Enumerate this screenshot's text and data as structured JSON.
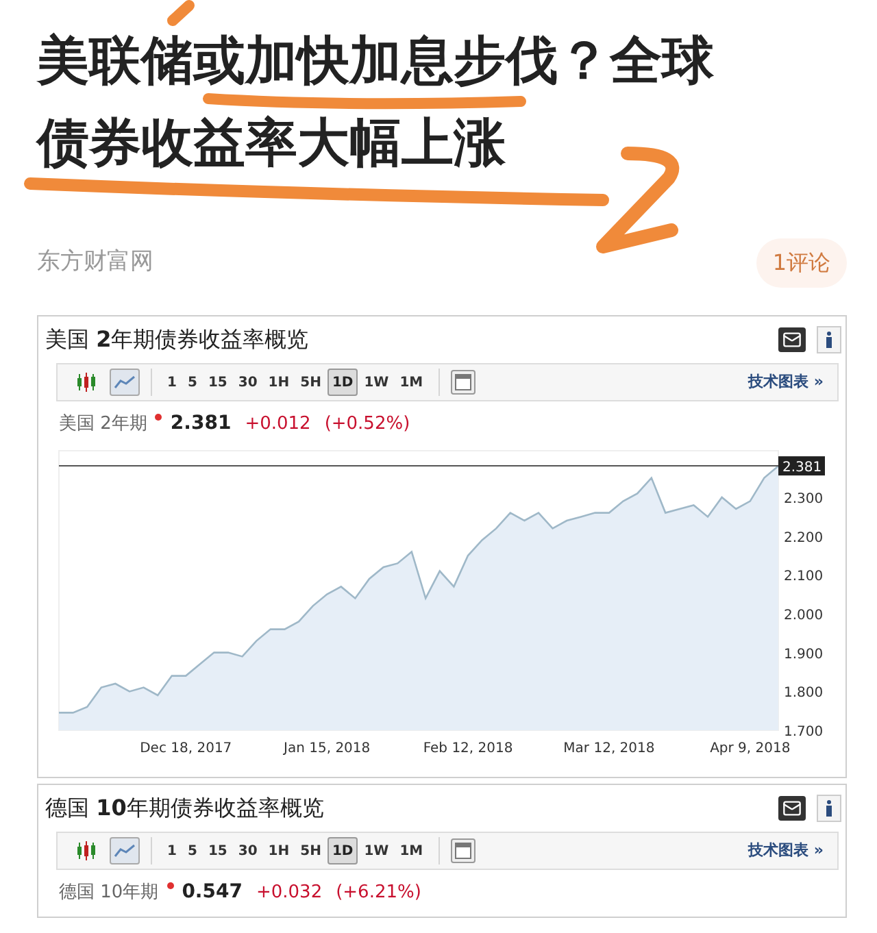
{
  "article": {
    "title_lines": [
      "美联储或加快加息步伐？全球",
      "债券收益率大幅上涨"
    ],
    "source": "东方财富网",
    "comments": "1评论"
  },
  "widgets": [
    {
      "title": "美国 **2**年期债券收益率概览",
      "chart_types": [
        {
          "kind": "candlestick",
          "selected": false
        },
        {
          "kind": "line",
          "selected": true
        }
      ],
      "intervals": [
        {
          "label": "1",
          "selected": false
        },
        {
          "label": "5",
          "selected": false
        },
        {
          "label": "15",
          "selected": false
        },
        {
          "label": "30",
          "selected": false
        },
        {
          "label": "1H",
          "selected": false
        },
        {
          "label": "5H",
          "selected": false
        },
        {
          "label": "1D",
          "selected": true
        },
        {
          "label": "1W",
          "selected": false
        },
        {
          "label": "1M",
          "selected": false
        }
      ],
      "link": "技术图表 »",
      "quote": {
        "name": "美国 2年期",
        "price": "2.381",
        "change": "+0.012",
        "change_pct": "(+0.52%)"
      },
      "chart_data": {
        "type": "area",
        "categories": [
          null,
          null,
          null,
          null,
          null,
          null,
          null,
          null,
          null,
          "Dec 18, 2017",
          null,
          null,
          null,
          null,
          null,
          null,
          null,
          null,
          null,
          "Jan 15, 2018",
          null,
          null,
          null,
          null,
          null,
          null,
          null,
          null,
          null,
          "Feb 12, 2018",
          null,
          null,
          null,
          null,
          null,
          null,
          null,
          null,
          null,
          "Mar 12, 2018",
          null,
          null,
          null,
          null,
          null,
          null,
          null,
          null,
          null,
          "Apr 9, 2018",
          null,
          null
        ],
        "series": [
          {
            "color": "#9fb8c8",
            "values": [
              1.745,
              1.745,
              1.76,
              1.81,
              1.82,
              1.8,
              1.81,
              1.79,
              1.84,
              1.84,
              1.87,
              1.9,
              1.9,
              1.89,
              1.93,
              1.96,
              1.96,
              1.98,
              2.02,
              2.05,
              2.07,
              2.04,
              2.09,
              2.12,
              2.13,
              2.16,
              2.04,
              2.11,
              2.07,
              2.15,
              2.19,
              2.22,
              2.26,
              2.24,
              2.26,
              2.22,
              2.24,
              2.25,
              2.26,
              2.26,
              2.29,
              2.31,
              2.35,
              2.26,
              2.27,
              2.28,
              2.25,
              2.3,
              2.27,
              2.29,
              2.35,
              2.381
            ]
          }
        ],
        "ylim": [
          1.7,
          2.42
        ],
        "ref_lines": [
          {
            "axis": "y",
            "value": 2.381,
            "label": "2.381"
          }
        ],
        "yticks": [
          {
            "value": 1.7,
            "label": "1.700"
          },
          {
            "value": 1.8,
            "label": "1.800"
          },
          {
            "value": 1.9,
            "label": "1.900"
          },
          {
            "value": 2.0,
            "label": "2.000"
          },
          {
            "value": 2.1,
            "label": "2.100"
          },
          {
            "value": 2.2,
            "label": "2.200"
          },
          {
            "value": 2.3,
            "label": "2.300"
          }
        ]
      }
    },
    {
      "title": "德国 **10**年期债券收益率概览",
      "chart_types": [
        {
          "kind": "candlestick",
          "selected": false
        },
        {
          "kind": "line",
          "selected": true
        }
      ],
      "intervals": [
        {
          "label": "1",
          "selected": false
        },
        {
          "label": "5",
          "selected": false
        },
        {
          "label": "15",
          "selected": false
        },
        {
          "label": "30",
          "selected": false
        },
        {
          "label": "1H",
          "selected": false
        },
        {
          "label": "5H",
          "selected": false
        },
        {
          "label": "1D",
          "selected": true
        },
        {
          "label": "1W",
          "selected": false
        },
        {
          "label": "1M",
          "selected": false
        }
      ],
      "link": "技术图表 »",
      "quote": {
        "name": "德国 10年期",
        "price": "0.547",
        "change": "+0.032",
        "change_pct": "(+6.21%)"
      }
    }
  ]
}
